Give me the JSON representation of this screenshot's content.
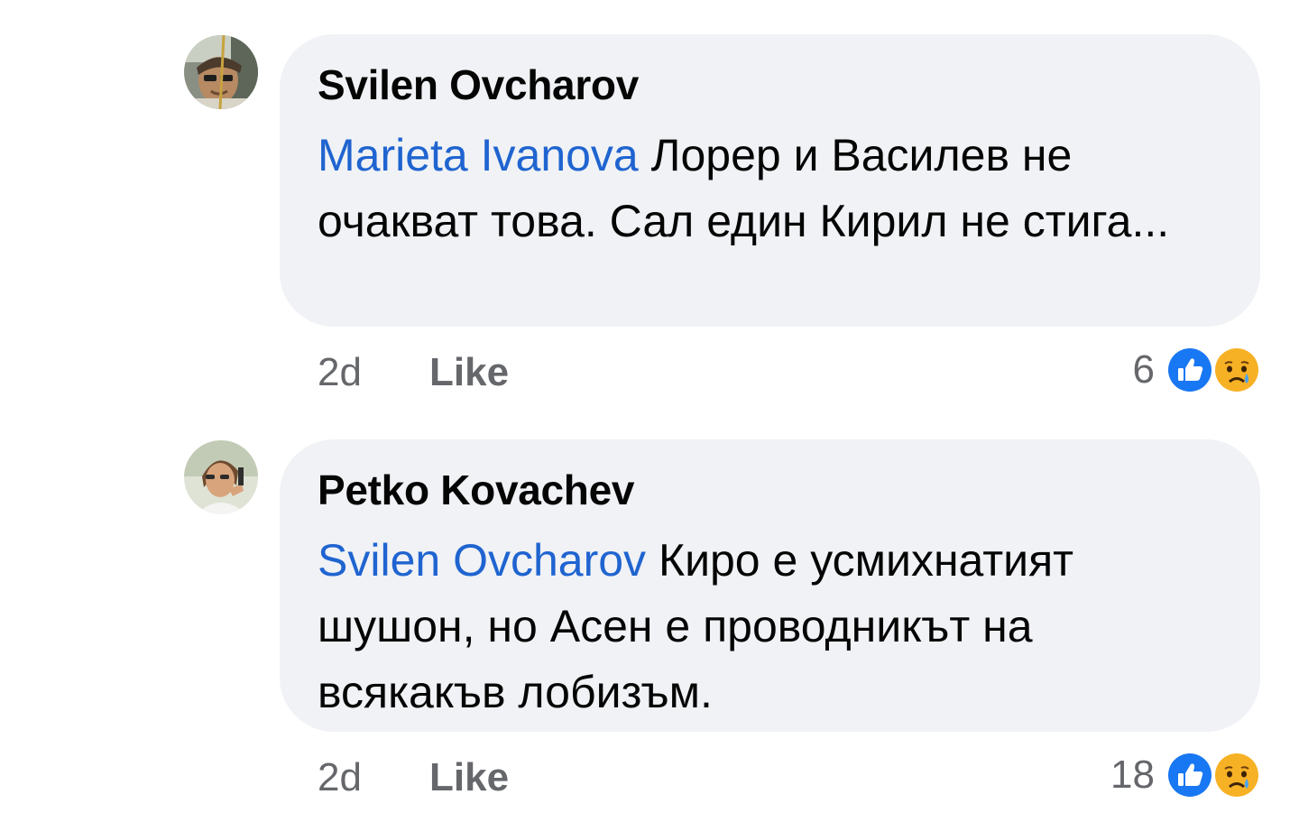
{
  "comments": [
    {
      "author": "Svilen Ovcharov",
      "mention": "Marieta Ivanova",
      "text": " Лорер и Василев не очакват това. Сал един Кирил не стига...",
      "time": "2d",
      "like_label": "Like",
      "reaction_count": "6",
      "reaction_icons": [
        "like-icon",
        "sad-icon"
      ]
    },
    {
      "author": "Petko Kovachev",
      "mention": "Svilen Ovcharov",
      "text": " Киро е усмихнатият шушон, но Асен е проводникът на всякакъв лобизъм.",
      "time": "2d",
      "like_label": "Like",
      "reaction_count": "18",
      "reaction_icons": [
        "like-icon",
        "sad-icon"
      ]
    }
  ],
  "colors": {
    "bubble": "#f0f2f5",
    "mention": "#1f64d0",
    "meta": "#65676b",
    "like_reaction": "#1877f2",
    "sad_reaction": "#f7b125"
  }
}
